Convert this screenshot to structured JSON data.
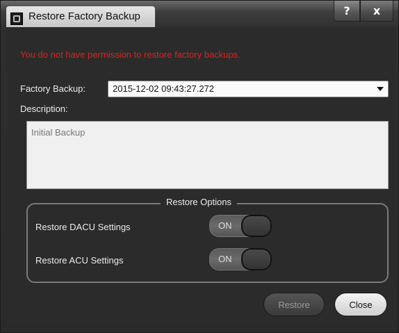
{
  "window": {
    "title": "Restore Factory Backup",
    "help_label": "?",
    "close_label": "x"
  },
  "warning": {
    "text": "You do not have permission to restore factory backups."
  },
  "form": {
    "factory_backup_label": "Factory Backup:",
    "factory_backup_value": "2015-12-02 09:43:27.272",
    "description_label": "Description:",
    "description_text": "Initial Backup"
  },
  "restore_options": {
    "title": "Restore Options",
    "items": [
      {
        "label": "Restore DACU Settings",
        "toggle": "ON"
      },
      {
        "label": "Restore ACU Settings",
        "toggle": "ON"
      }
    ]
  },
  "buttons": {
    "restore": "Restore",
    "close": "Close"
  },
  "colors": {
    "warning": "#e0211a",
    "background": "#2b2b2b"
  }
}
